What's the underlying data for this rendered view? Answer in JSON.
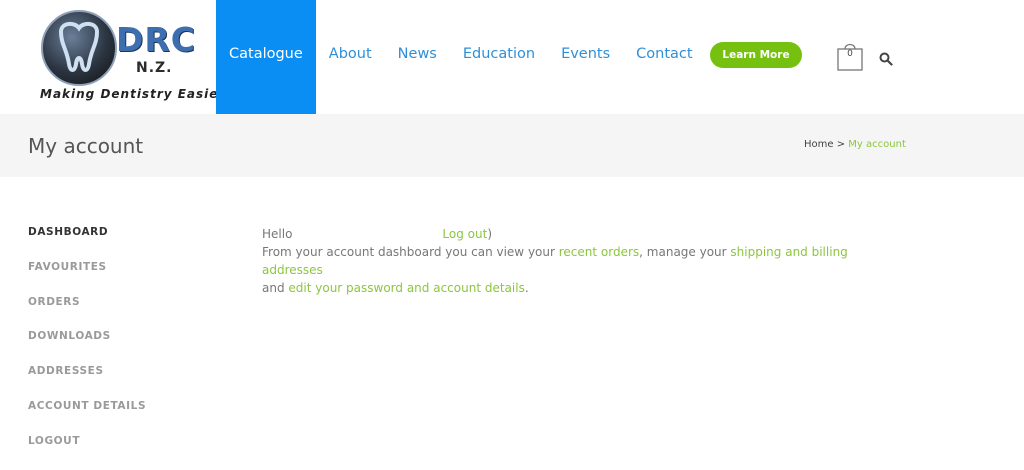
{
  "brand": {
    "name": "DRC",
    "region": "N.Z.",
    "tagline": "Making Dentistry Easier"
  },
  "nav": {
    "items": [
      {
        "label": "Catalogue",
        "active": true
      },
      {
        "label": "About"
      },
      {
        "label": "News"
      },
      {
        "label": "Education"
      },
      {
        "label": "Events"
      },
      {
        "label": "Contact"
      }
    ],
    "cta_label": "Learn More",
    "cart_count": "0",
    "icons": [
      "cart-icon",
      "search-icon"
    ]
  },
  "title_bar": {
    "title": "My account",
    "breadcrumb_home": "Home",
    "breadcrumb_sep": ">",
    "breadcrumb_current": "My account"
  },
  "sidebar": {
    "items": [
      {
        "label": "DASHBOARD",
        "active": true
      },
      {
        "label": "FAVOURITES"
      },
      {
        "label": "ORDERS"
      },
      {
        "label": "DOWNLOADS"
      },
      {
        "label": "ADDRESSES"
      },
      {
        "label": "ACCOUNT DETAILS"
      },
      {
        "label": "LOGOUT"
      }
    ]
  },
  "content": {
    "hello": "Hello",
    "logout_link": "Log out",
    "logout_close": ")",
    "line1_prefix": "From your account dashboard you can view your ",
    "recent_orders_link": "recent orders",
    "line1_mid": ", manage your ",
    "addresses_link": "shipping and billing addresses",
    "line2_prefix": "and ",
    "account_link": "edit your password and account details",
    "line2_suffix": "."
  },
  "colors": {
    "nav_active_bg": "#0b8ef3",
    "nav_link": "#2f8fd8",
    "accent_green": "#76c10f",
    "link_green": "#8cc63e",
    "title_bar_bg": "#f5f5f5"
  }
}
